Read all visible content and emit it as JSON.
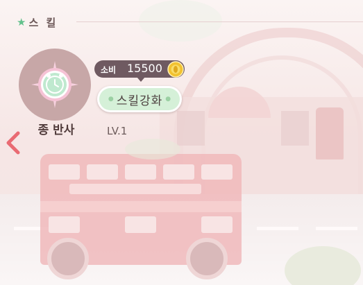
{
  "header": {
    "title": "스 킬",
    "star_icon": "star-icon"
  },
  "nav": {
    "back_icon": "chevron-left-icon"
  },
  "skill": {
    "name": "종 반사",
    "level": "LV.1",
    "icon": "clock-gem-icon"
  },
  "cost": {
    "label": "소비",
    "value": "15500",
    "icon": "gold-coin-icon"
  },
  "enhance_button": {
    "label": "스킬강화"
  },
  "colors": {
    "accent_green": "#62c18c",
    "pill": "#6f5a61",
    "button_fill": "#d5f0d8",
    "back_arrow": "#e96b73",
    "coin": "#f2c230"
  }
}
